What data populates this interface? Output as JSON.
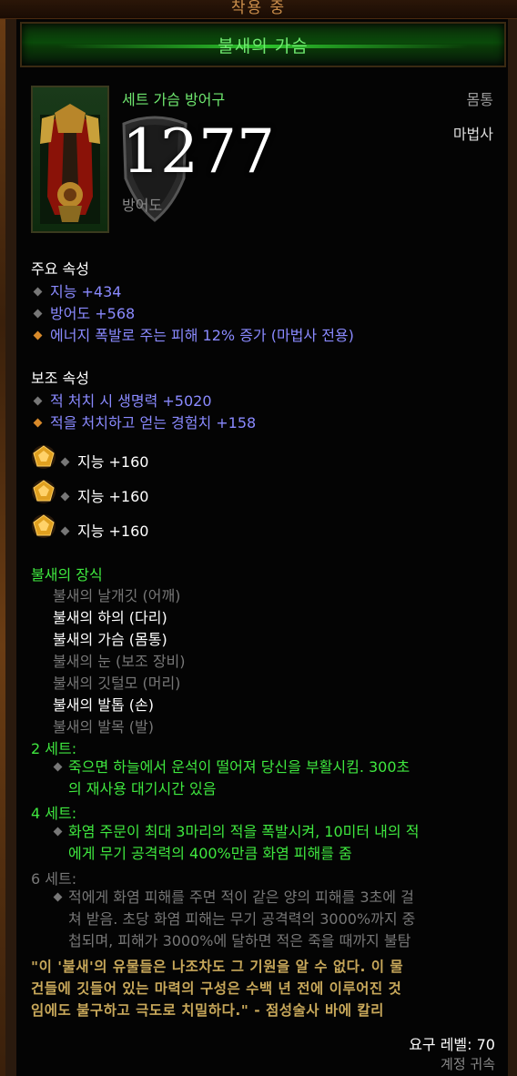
{
  "header": {
    "equipped": "착용 중",
    "item_name": "불새의 가슴"
  },
  "item": {
    "type": "세트 가슴 방어구",
    "slot": "몸통",
    "class": "마법사",
    "armor_value": "1277",
    "armor_label": "방어도",
    "icon": "firebird-chest-armor-icon"
  },
  "primary": {
    "heading": "주요 속성",
    "stats": [
      {
        "text": "지능 +434",
        "bullet": "gray"
      },
      {
        "text": "방어도 +568",
        "bullet": "gray"
      },
      {
        "text": "에너지 폭발로 주는 피해 12% 증가 (마법사 전용)",
        "bullet": "orange"
      }
    ]
  },
  "secondary": {
    "heading": "보조 속성",
    "stats": [
      {
        "text": "적 처치 시 생명력 +5020",
        "bullet": "gray"
      },
      {
        "text": "적을 처치하고 얻는 경험치 +158",
        "bullet": "orange"
      }
    ]
  },
  "sockets": [
    {
      "text": "지능 +160",
      "icon": "topaz-gem-icon"
    },
    {
      "text": "지능 +160",
      "icon": "topaz-gem-icon"
    },
    {
      "text": "지능 +160",
      "icon": "topaz-gem-icon"
    }
  ],
  "set": {
    "name": "불새의 장식",
    "pieces": [
      {
        "text": "불새의 날개깃 (어깨)",
        "owned": false
      },
      {
        "text": "불새의 하의 (다리)",
        "owned": true
      },
      {
        "text": "불새의 가슴 (몸통)",
        "owned": true
      },
      {
        "text": "불새의 눈 (보조 장비)",
        "owned": false
      },
      {
        "text": "불새의 깃털모 (머리)",
        "owned": false
      },
      {
        "text": "불새의 발톱 (손)",
        "owned": true
      },
      {
        "text": "불새의 발목 (발)",
        "owned": false
      }
    ],
    "bonuses": [
      {
        "head": "2 세트:",
        "lines": [
          "죽으면 하늘에서 운석이 떨어져 당신을 부활시킴. 300초",
          "의 재사용 대기시간 있음"
        ],
        "active": true
      },
      {
        "head": "4 세트:",
        "lines": [
          "화염 주문이 최대 3마리의 적을 폭발시켜, 10미터 내의 적",
          "에게 무기 공격력의 400%만큼 화염 피해를 줌"
        ],
        "active": true
      },
      {
        "head": "6 세트:",
        "lines": [
          "적에게 화염 피해를 주면 적이 같은 양의 피해를 3초에 걸",
          "쳐 받음. 초당 화염 피해는 무기 공격력의 3000%까지 중",
          "첩되며, 피해가 3000%에 달하면 적은 죽을 때까지 불탐"
        ],
        "active": false
      }
    ]
  },
  "flavor": {
    "lines": [
      "\"이 '불새'의 유물들은 나조차도 그 기원을 알 수 없다. 이 물",
      "건들에 깃들어 있는 마력의 구성은 수백 년 전에 이루어진 것",
      "임에도 불구하고 극도로 치밀하다.\" - 점성술사 바에 칼리"
    ]
  },
  "footer": {
    "required_level": "요구 레벨: 70",
    "bound": "계정 귀속"
  },
  "colors": {
    "set_green": "#3fe83f",
    "magic_blue": "#8a8aff",
    "legendary_orange": "#d88a2a",
    "flavor_gold": "#c8a85a"
  }
}
